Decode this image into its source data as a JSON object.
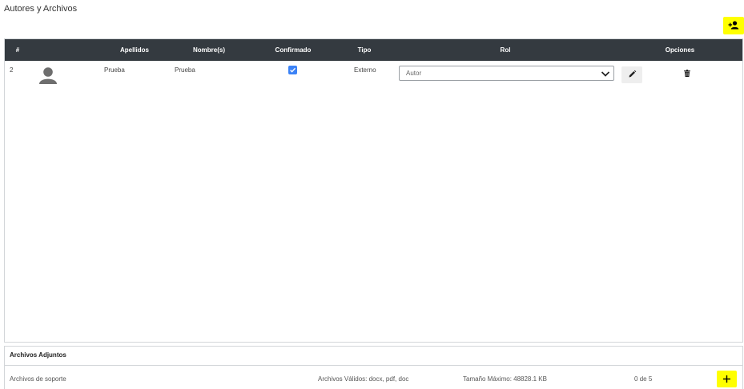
{
  "page": {
    "title": "Autores y Archivos"
  },
  "table": {
    "headers": [
      "#",
      "Apellidos",
      "Nombre(s)",
      "Confirmado",
      "Tipo",
      "Rol",
      "Opciones"
    ],
    "rows": [
      {
        "num": "2",
        "apellidos": "Prueba",
        "nombres": "Prueba",
        "confirmado": true,
        "tipo": "Externo",
        "rol": "Autor"
      }
    ]
  },
  "attachments": {
    "title": "Archivos Adjuntos",
    "row": {
      "name": "Archivos de soporte",
      "valid_types": "Archivos Válidos: docx, pdf, doc",
      "max_size": "Tamaño Máximo: 48828.1 KB",
      "count_current": "0",
      "count_sep": "de",
      "count_total": "5"
    }
  },
  "icons": {
    "add_author": "user-plus-icon",
    "avatar": "user-silhouette-icon",
    "check": "check-icon",
    "chevron": "chevron-down-icon",
    "edit": "pencil-icon",
    "delete": "trash-icon",
    "add_file": "plus-icon"
  },
  "colors": {
    "accent": "#ffff00",
    "header_bg": "#343a40",
    "checkbox": "#3b82f6"
  }
}
